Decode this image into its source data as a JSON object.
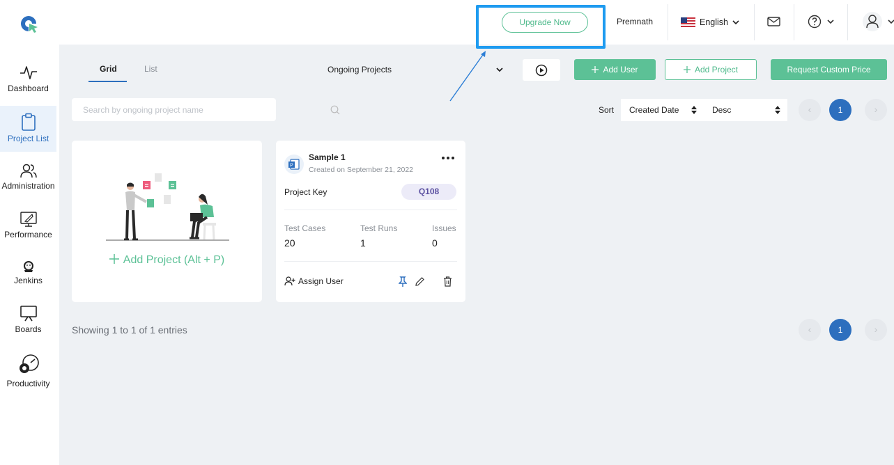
{
  "header": {
    "upgrade_label": "Upgrade Now",
    "user_name": "Premnath",
    "language": "English"
  },
  "sidebar": {
    "items": [
      {
        "label": "Dashboard",
        "icon": "activity-icon"
      },
      {
        "label": "Project List",
        "icon": "clipboard-icon",
        "active": true
      },
      {
        "label": "Administration",
        "icon": "users-icon"
      },
      {
        "label": "Performance",
        "icon": "rocket-chart-icon"
      },
      {
        "label": "Jenkins",
        "icon": "jenkins-icon"
      },
      {
        "label": "Boards",
        "icon": "board-icon"
      },
      {
        "label": "Productivity",
        "icon": "gear-gauge-icon"
      }
    ]
  },
  "toolbar": {
    "tabs": [
      {
        "label": "Grid",
        "active": true
      },
      {
        "label": "List",
        "active": false
      }
    ],
    "filter_label": "Ongoing Projects",
    "add_user_label": "Add User",
    "add_project_label": "Add Project",
    "request_price_label": "Request Custom Price",
    "search_placeholder": "Search by ongoing project name",
    "sort_label": "Sort",
    "sort_field": "Created Date",
    "sort_order": "Desc",
    "current_page": "1"
  },
  "add_card": {
    "label": "Add Project (Alt + P)"
  },
  "project": {
    "name": "Sample 1",
    "created": "Created on September 21, 2022",
    "key_label": "Project Key",
    "key": "Q108",
    "stats": [
      {
        "label": "Test Cases",
        "value": "20"
      },
      {
        "label": "Test Runs",
        "value": "1"
      },
      {
        "label": "Issues",
        "value": "0"
      }
    ],
    "assign_label": "Assign User"
  },
  "footer": {
    "showing": "Showing 1 to 1 of 1 entries",
    "current_page": "1"
  },
  "colors": {
    "accent_green": "#5cc196",
    "primary_blue": "#2d6fbe",
    "highlight_blue": "#1e9bf0",
    "background": "#eef1f4"
  }
}
